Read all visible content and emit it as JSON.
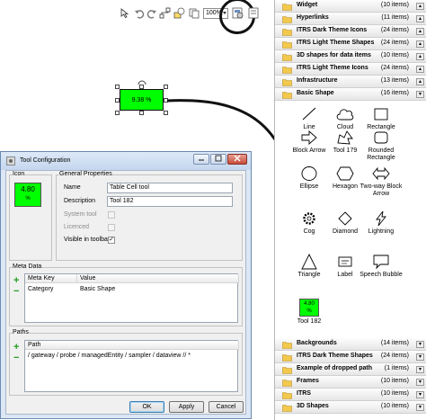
{
  "toolbar": {
    "zoom_value": "100%",
    "icons": [
      "cursor-icon",
      "undo-icon",
      "redo-icon",
      "connector-icon",
      "shapes-icon",
      "copy-icon",
      "paste-icon",
      "tool-config-icon",
      "properties-icon"
    ]
  },
  "canvas": {
    "widget_text": "9.38 %"
  },
  "palette": {
    "top_categories": [
      {
        "name": "Widget",
        "count": "(10 items)"
      },
      {
        "name": "Hyperlinks",
        "count": "(11 items)"
      },
      {
        "name": "ITRS Dark Theme Icons",
        "count": "(24 items)"
      },
      {
        "name": "ITRS Light Theme Shapes",
        "count": "(24 items)"
      },
      {
        "name": "3D shapes for data items",
        "count": "(10 items)"
      },
      {
        "name": "ITRS Light Theme Icons",
        "count": "(24 items)"
      },
      {
        "name": "Infrastructure",
        "count": "(13 items)"
      },
      {
        "name": "Basic Shape",
        "count": "(16 items)"
      }
    ],
    "shapes": [
      {
        "label": "Line",
        "icon": "line-icon"
      },
      {
        "label": "Cloud",
        "icon": "cloud-icon"
      },
      {
        "label": "Rectangle",
        "icon": "rectangle-icon"
      },
      {
        "label": "Block Arrow",
        "icon": "block-arrow-icon"
      },
      {
        "label": "Tool 179",
        "icon": "tool-179-icon"
      },
      {
        "label": "Rounded Rectangle",
        "icon": "rounded-rectangle-icon"
      },
      {
        "label": "Ellipse",
        "icon": "ellipse-icon"
      },
      {
        "label": "Hexagon",
        "icon": "hexagon-icon"
      },
      {
        "label": "Two-way Block Arrow",
        "icon": "two-way-block-arrow-icon"
      },
      {
        "label": "Cog",
        "icon": "cog-icon"
      },
      {
        "label": "Diamond",
        "icon": "diamond-icon"
      },
      {
        "label": "Lightning",
        "icon": "lightning-icon"
      },
      {
        "label": "Triangle",
        "icon": "triangle-icon"
      },
      {
        "label": "Label",
        "icon": "label-icon"
      },
      {
        "label": "Speech Bubble",
        "icon": "speech-bubble-icon"
      },
      {
        "label": "Tool 182",
        "icon": "tool-182-icon"
      }
    ],
    "tool182_value": "4.80",
    "tool182_unit": "%",
    "bottom_categories": [
      {
        "name": "Backgrounds",
        "count": "(14 items)"
      },
      {
        "name": "ITRS Dark Theme Shapes",
        "count": "(24 items)"
      },
      {
        "name": "Example of dropped path",
        "count": "(1 items)"
      },
      {
        "name": "Frames",
        "count": "(10 items)"
      },
      {
        "name": "ITRS",
        "count": "(10 items)"
      },
      {
        "name": "3D Shapes",
        "count": "(10 items)"
      }
    ]
  },
  "dialog": {
    "title": "Tool Configuration",
    "icon_group": "Icon",
    "icon_value": "4.80",
    "icon_unit": "%",
    "general_group": "General Properties",
    "name_label": "Name",
    "name_value": "Table Cell tool",
    "description_label": "Description",
    "description_value": "Tool 182",
    "system_tool_label": "System tool",
    "licenced_label": "Licenced",
    "visible_label": "Visible in toolbar",
    "visible_checked": true,
    "meta_group": "Meta Data",
    "meta_columns": [
      "Meta Key",
      "Value"
    ],
    "meta_rows": [
      {
        "key": "Category",
        "value": "Basic Shape"
      }
    ],
    "paths_group": "Paths",
    "paths_column": "Path",
    "paths_rows": [
      "/ gateway / probe / managedEntity / sampler / dataview // *"
    ],
    "ok_label": "OK",
    "apply_label": "Apply",
    "cancel_label": "Cancel",
    "plus_symbol": "+",
    "minus_symbol": "−",
    "check_mark": "✓"
  }
}
